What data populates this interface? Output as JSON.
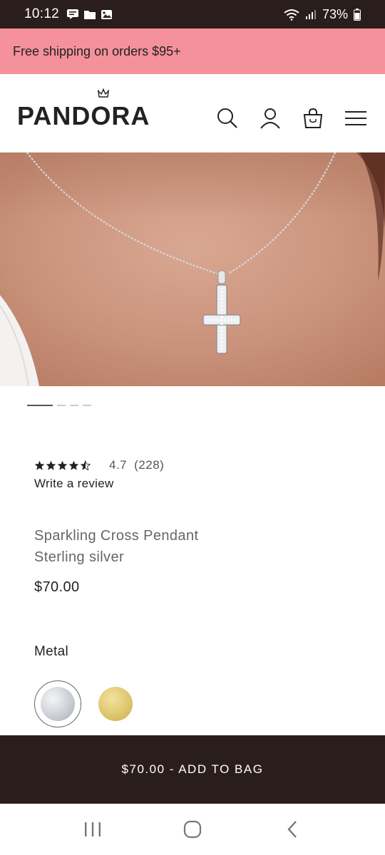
{
  "status": {
    "time": "10:12",
    "battery": "73%",
    "left_icons": [
      "message-icon",
      "folder-icon",
      "gallery-icon"
    ],
    "right_icons": [
      "wifi-icon",
      "signal-icon",
      "battery-icon"
    ]
  },
  "promo": {
    "text": "Free shipping on orders $95+",
    "background": "#f5919a"
  },
  "header": {
    "logo": "PANDORA",
    "icons": [
      "search-icon",
      "account-icon",
      "bag-icon",
      "menu-icon"
    ]
  },
  "gallery": {
    "image": "cross-pendant-necklace-on-model",
    "slides": 4,
    "active_slide": 1
  },
  "product": {
    "rating_stars": 4.7,
    "rating_value": "4.7",
    "rating_count": "(228)",
    "write_review": "Write a review",
    "name": "Sparkling Cross Pendant",
    "material": "Sterling silver",
    "price": "$70.00"
  },
  "metal": {
    "label": "Metal",
    "options": [
      {
        "name": "silver",
        "color": "#c8ccd2",
        "selected": true
      },
      {
        "name": "gold",
        "color": "#dcc46a",
        "selected": false
      }
    ]
  },
  "cta": {
    "label": "$70.00 - ADD TO BAG",
    "background": "#2a1e1c"
  },
  "navbar": {
    "icons": [
      "recent-apps-icon",
      "home-icon",
      "back-icon"
    ]
  }
}
